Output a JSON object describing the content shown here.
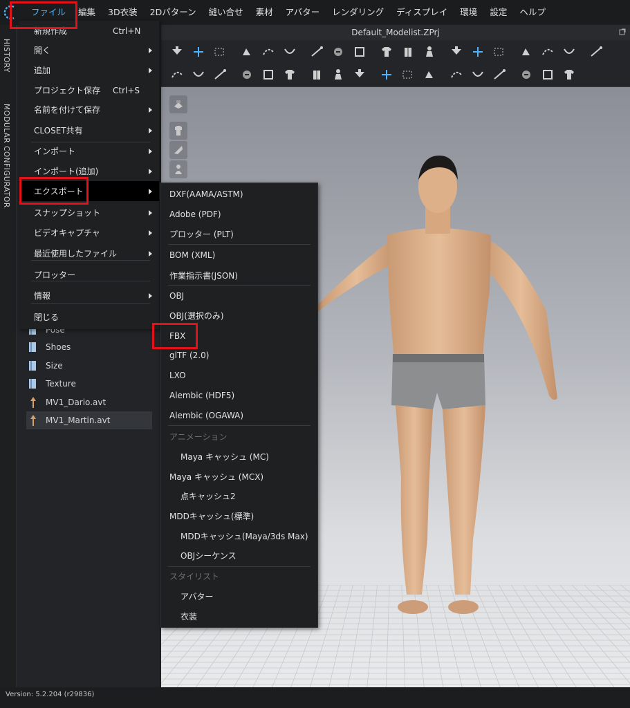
{
  "menubar": {
    "items": [
      "ファイル",
      "編集",
      "3D衣装",
      "2Dパターン",
      "縫い合せ",
      "素材",
      "アバター",
      "レンダリング",
      "ディスプレイ",
      "環境",
      "設定",
      "ヘルプ"
    ],
    "active": "ファイル"
  },
  "side_tabs": [
    "HISTORY",
    "MODULAR CONFIGURATOR"
  ],
  "library": {
    "items": [
      {
        "label": "Pose",
        "icon": "book-icon"
      },
      {
        "label": "Shoes",
        "icon": "book-icon"
      },
      {
        "label": "Size",
        "icon": "book-icon"
      },
      {
        "label": "Texture",
        "icon": "book-icon"
      },
      {
        "label": "MV1_Dario.avt",
        "icon": "avatar-file-icon"
      },
      {
        "label": "MV1_Martin.avt",
        "icon": "avatar-file-icon",
        "selected": true
      }
    ]
  },
  "viewport": {
    "title": "Default_Modelist.ZPrj"
  },
  "file_menu": {
    "items": [
      {
        "label": "新規作成",
        "shortcut": "Ctrl+N",
        "submenu": false
      },
      {
        "label": "開く",
        "shortcut": "",
        "submenu": true
      },
      {
        "label": "追加",
        "shortcut": "",
        "submenu": true
      },
      {
        "label": "プロジェクト保存",
        "shortcut": "Ctrl+S",
        "submenu": false
      },
      {
        "label": "名前を付けて保存",
        "shortcut": "",
        "submenu": true
      },
      {
        "label": "CLOSET共有",
        "shortcut": "",
        "submenu": true
      },
      {
        "label": "インポート",
        "shortcut": "",
        "submenu": true
      },
      {
        "label": "インポート(追加)",
        "shortcut": "",
        "submenu": true
      },
      {
        "label": "エクスポート",
        "shortcut": "",
        "submenu": true,
        "highlighted": true
      },
      {
        "label": "スナップショット",
        "shortcut": "",
        "submenu": true
      },
      {
        "label": "ビデオキャプチャ",
        "shortcut": "",
        "submenu": true
      },
      {
        "label": "最近使用したファイル",
        "shortcut": "",
        "submenu": true
      },
      {
        "label": "プロッター",
        "shortcut": "",
        "submenu": false
      },
      {
        "label": "情報",
        "shortcut": "",
        "submenu": true
      },
      {
        "label": "閉じる",
        "shortcut": "",
        "submenu": false
      }
    ]
  },
  "export_menu": {
    "items": [
      {
        "label": "DXF(AAMA/ASTM)"
      },
      {
        "label": "Adobe (PDF)"
      },
      {
        "label": "プロッター (PLT)"
      },
      {
        "label": "BOM (XML)"
      },
      {
        "label": "作業指示書(JSON)"
      },
      {
        "label": "OBJ"
      },
      {
        "label": "OBJ(選択のみ)"
      },
      {
        "label": "FBX"
      },
      {
        "label": "glTF (2.0)"
      },
      {
        "label": "LXO"
      },
      {
        "label": "Alembic (HDF5)"
      },
      {
        "label": "Alembic (OGAWA)"
      },
      {
        "label": "アニメーション",
        "section": true
      },
      {
        "label": "Maya キャッシュ (MC)",
        "indent": true
      },
      {
        "label": "Maya キャッシュ (MCX)"
      },
      {
        "label": "点キャッシュ2",
        "indent": true
      },
      {
        "label": "MDDキャッシュ(標準)"
      },
      {
        "label": "MDDキャッシュ(Maya/3ds Max)",
        "indent": true
      },
      {
        "label": "OBJシーケンス",
        "indent": true
      },
      {
        "label": "スタイリスト",
        "section": true
      },
      {
        "label": "アバター",
        "indent": true
      },
      {
        "label": "衣装",
        "indent": true
      }
    ]
  },
  "statusbar": {
    "version": "Version: 5.2.204 (r29836)"
  },
  "colors": {
    "accent": "#4db4ff",
    "annotation": "#e3121a",
    "menu_bg": "#1f2022",
    "highlight_bg": "#000000"
  }
}
